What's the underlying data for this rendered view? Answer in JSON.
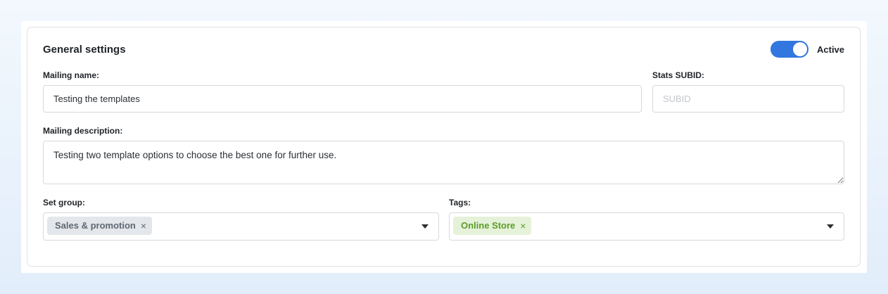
{
  "colors": {
    "accent": "#3277e0",
    "tag_green": "#5c9c2a"
  },
  "settings": {
    "title": "General settings",
    "active_label": "Active",
    "active": true
  },
  "mailing_name": {
    "label": "Mailing name:",
    "value": "Testing the templates"
  },
  "stats_subid": {
    "label": "Stats SUBID:",
    "placeholder": "SUBID",
    "value": ""
  },
  "description": {
    "label": "Mailing description:",
    "value": "Testing two template options to choose the best one for further use."
  },
  "group": {
    "label": "Set group:",
    "chips": [
      "Sales & promotion"
    ],
    "remove_icon": "×"
  },
  "tags": {
    "label": "Tags:",
    "chips": [
      "Online Store"
    ],
    "remove_icon": "×"
  }
}
